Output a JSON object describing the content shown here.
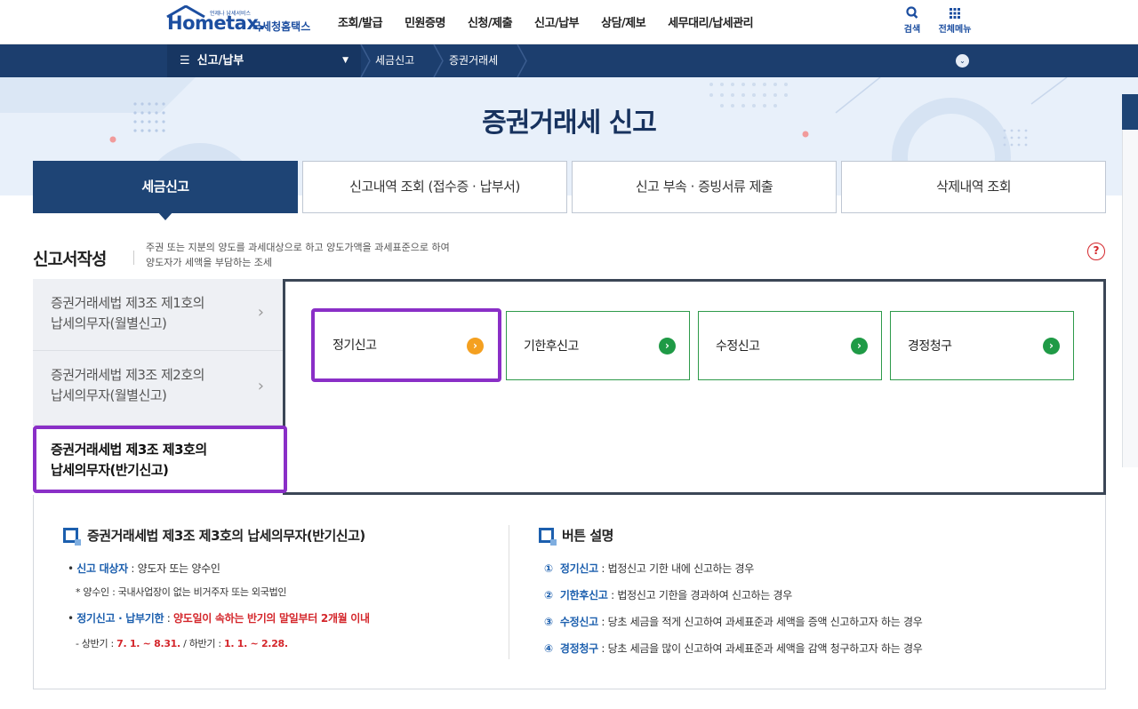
{
  "header": {
    "logo_text": "Hometax.",
    "logo_sub": "언제나 납세서비스",
    "logo_kr": "국세청홈택스",
    "gnb": [
      "조회/발급",
      "민원증명",
      "신청/제출",
      "신고/납부",
      "상담/제보",
      "세무대리/납세관리"
    ],
    "search_label": "검색",
    "allmenu_label": "전체메뉴"
  },
  "location": {
    "main": "신고/납부",
    "crumbs": [
      "세금신고",
      "증권거래세"
    ]
  },
  "hero": {
    "title": "증권거래세 신고"
  },
  "tabs": [
    {
      "label": "세금신고",
      "active": true
    },
    {
      "label": "신고내역 조회 (접수증 · 납부서)",
      "active": false
    },
    {
      "label": "신고 부속 · 증빙서류 제출",
      "active": false
    },
    {
      "label": "삭제내역 조회",
      "active": false
    }
  ],
  "section": {
    "title": "신고서작성",
    "desc_line1": "주권 또는 지분의 양도를 과세대상으로 하고 양도가액을 과세표준으로 하여",
    "desc_line2": "양도자가 세액을 부담하는 조세",
    "help": "?"
  },
  "left_menu": [
    {
      "line1": "증권거래세법 제3조 제1호의",
      "line2": "납세의무자(월별신고)",
      "active": false
    },
    {
      "line1": "증권거래세법 제3조 제2호의",
      "line2": "납세의무자(월별신고)",
      "active": false
    },
    {
      "line1": "증권거래세법 제3조 제3호의",
      "line2": "납세의무자(반기신고)",
      "active": true
    }
  ],
  "action_buttons": [
    {
      "label": "정기신고",
      "selected": true
    },
    {
      "label": "기한후신고",
      "selected": false
    },
    {
      "label": "수정신고",
      "selected": false
    },
    {
      "label": "경정청구",
      "selected": false
    }
  ],
  "info_left": {
    "title": "증권거래세법 제3조 제3호의 납세의무자(반기신고)",
    "target_label": "신고 대상자",
    "target_value": " : 양도자 또는 양수인",
    "note": "양수인 : 국내사업장이 없는 비거주자 또는 외국법인",
    "deadline_label": "정기신고 · 납부기한",
    "deadline_sep": " : ",
    "deadline_value": "양도일이 속하는 반기의 말일부터 2개월 이내",
    "period_prefix": "- 상반기 : ",
    "period_first": "7. 1. ~ 8.31.",
    "period_mid": " / 하반기 : ",
    "period_second": "1. 1. ~ 2.28."
  },
  "info_right": {
    "title": "버튼 설명",
    "items": [
      {
        "num": "①",
        "label": "정기신고",
        "desc": " : 법정신고 기한 내에 신고하는 경우"
      },
      {
        "num": "②",
        "label": "기한후신고",
        "desc": " : 법정신고 기한을 경과하여 신고하는 경우"
      },
      {
        "num": "③",
        "label": "수정신고",
        "desc": " : 당초 세금을 적게 신고하여 과세표준과 세액을 증액 신고하고자 하는 경우"
      },
      {
        "num": "④",
        "label": "경정청구",
        "desc": " : 당초 세금을 많이 신고하여 과세표준과 세액을 감액 청구하고자 하는 경우"
      }
    ]
  },
  "colors": {
    "navy": "#1e4475",
    "green": "#1f9a46",
    "orange": "#f4a020",
    "purple_highlight": "#8a2fc7",
    "red": "#d4262b"
  }
}
